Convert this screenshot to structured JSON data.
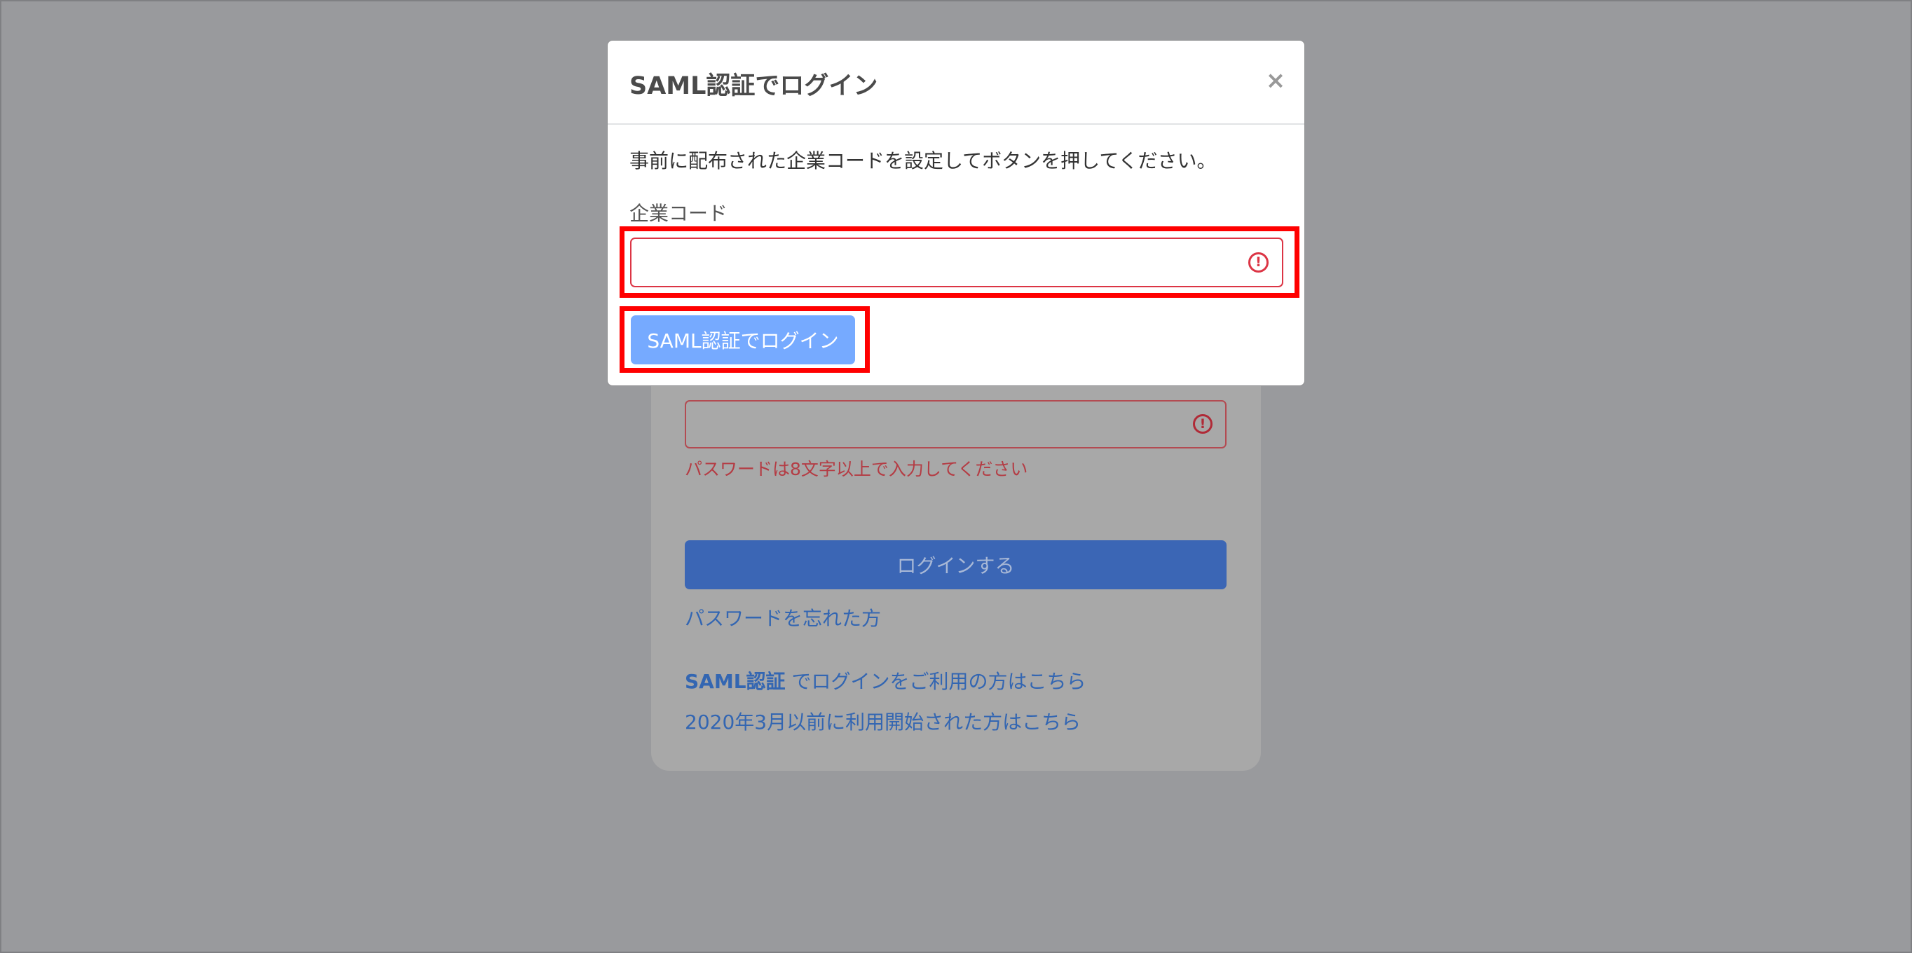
{
  "background_login": {
    "password_error": "パスワードは8文字以上で入力してください",
    "login_button_label": "ログインする",
    "forgot_password_link": "パスワードを忘れた方",
    "saml_link_bold": "SAML認証",
    "saml_link_rest": " でログインをご利用の方はこちら",
    "legacy_link": "2020年3月以前に利用開始された方はこちら"
  },
  "modal": {
    "title": "SAML認証でログイン",
    "close_label": "×",
    "description": "事前に配布された企業コードを設定してボタンを押してください。",
    "field_label": "企業コード",
    "input_value": "",
    "submit_label": "SAML認証でログイン"
  },
  "colors": {
    "overlay": "#999a9d",
    "error": "#dc3545",
    "primary_button": "#76aaff",
    "highlight": "#ff0000"
  }
}
